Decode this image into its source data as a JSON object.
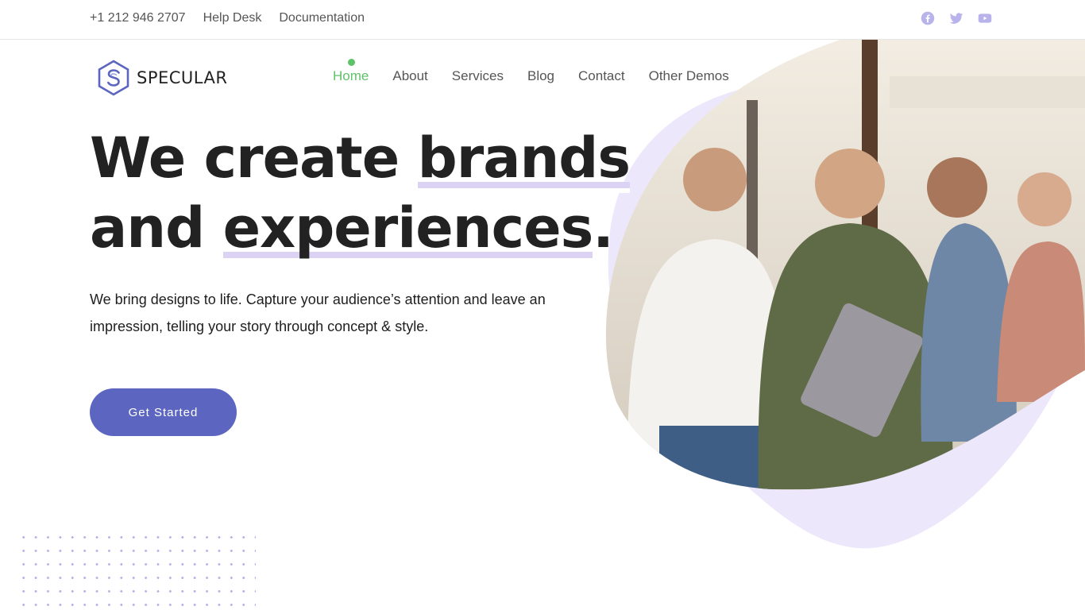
{
  "topbar": {
    "phone": "+1 212 946 2707",
    "help": "Help Desk",
    "docs": "Documentation",
    "social_icons": [
      "facebook-icon",
      "twitter-icon",
      "youtube-icon"
    ]
  },
  "brand": {
    "name": "SPECULAR"
  },
  "nav": {
    "items": [
      {
        "label": "Home",
        "active": true
      },
      {
        "label": "About"
      },
      {
        "label": "Services"
      },
      {
        "label": "Blog"
      },
      {
        "label": "Contact"
      },
      {
        "label": "Other Demos"
      }
    ]
  },
  "hero": {
    "line1_a": "We create ",
    "line1_b": "brands",
    "line2_a": "and ",
    "line2_b": "experiences",
    "line2_c": ".",
    "description": "We bring designs to life. Capture your audience’s attention and leave an impression, telling your story through concept & style.",
    "cta": "Get Started"
  },
  "colors": {
    "accent": "#5c66c0",
    "active_nav": "#5ec269",
    "highlight": "#dcd3f4",
    "blob": "#ede7fb",
    "social": "#b8b3ea"
  }
}
